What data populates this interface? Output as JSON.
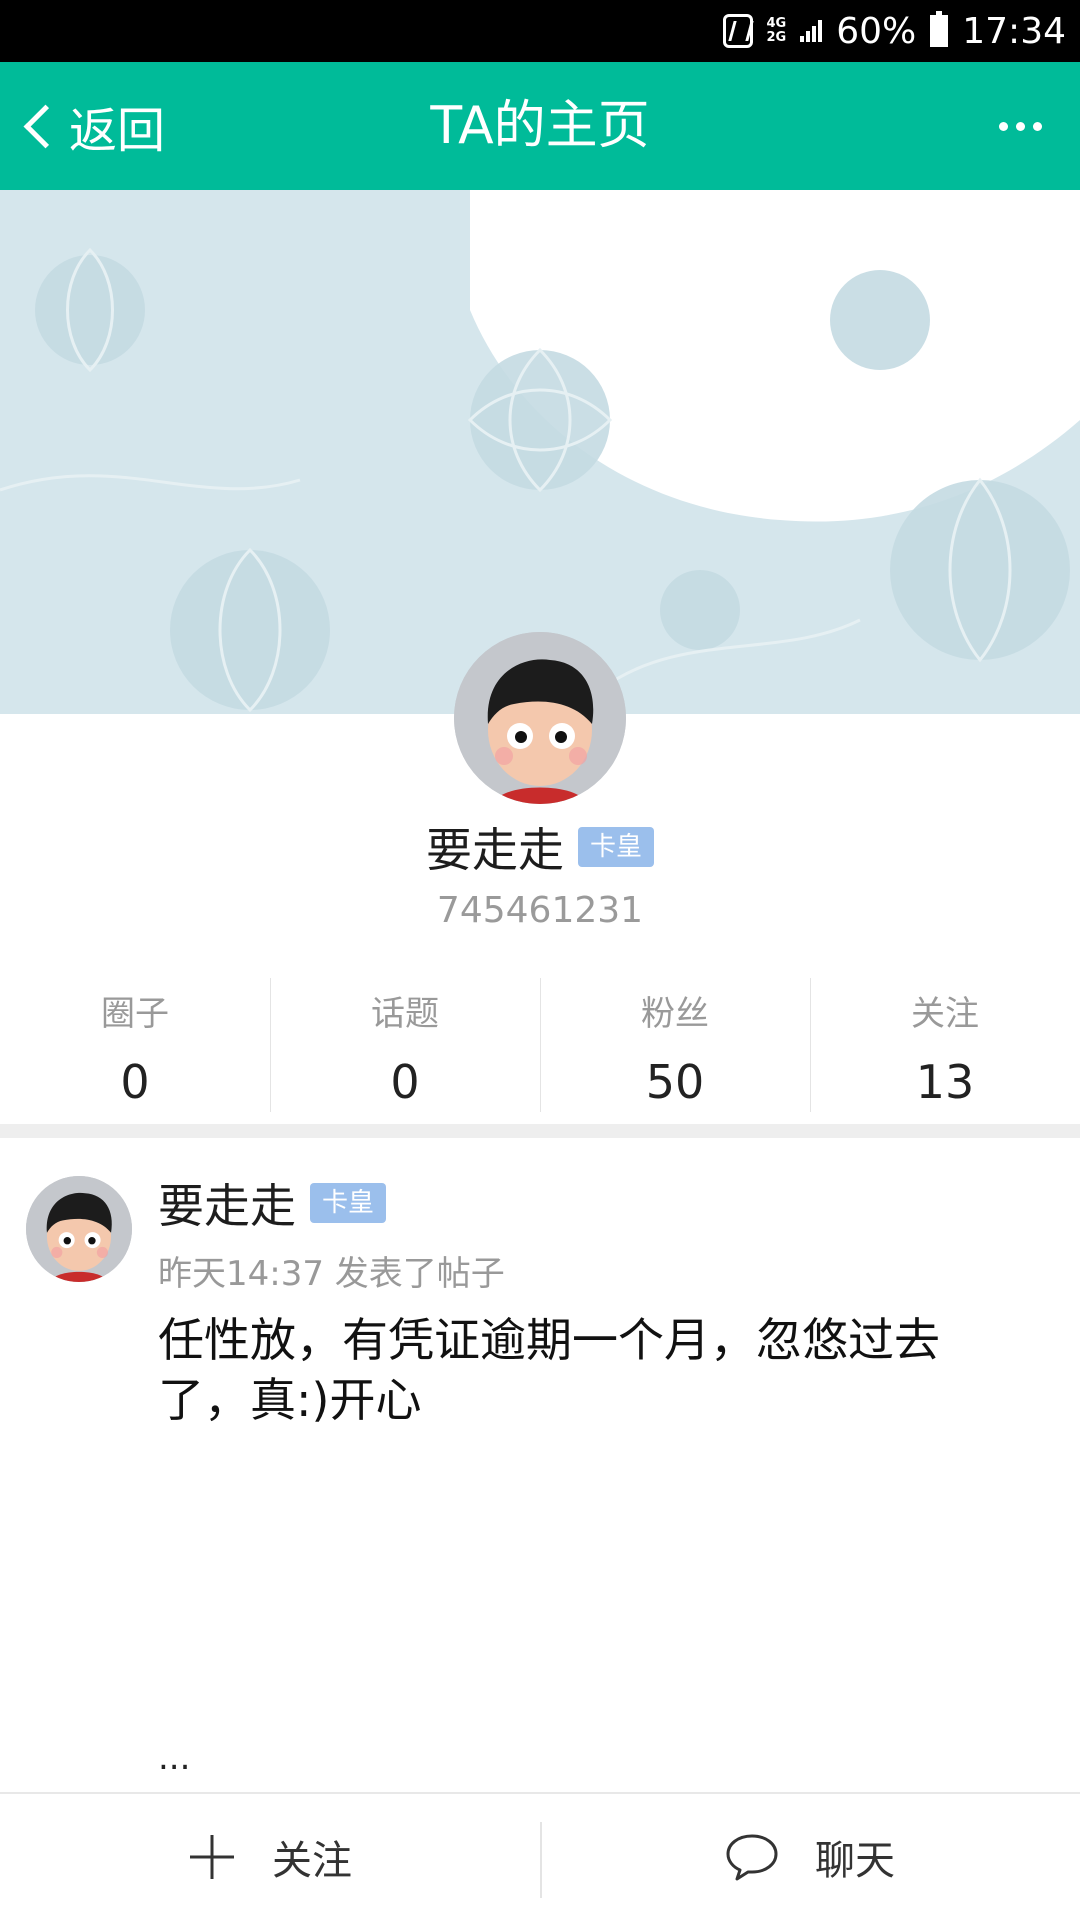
{
  "status_bar": {
    "net_top": "4G",
    "net_bottom": "2G",
    "battery": "60%",
    "time": "17:34"
  },
  "nav": {
    "back_label": "返回",
    "title": "TA的主页",
    "accent_color": "#00bb99"
  },
  "profile": {
    "name": "要走走",
    "badge": "卡皇",
    "id": "745461231"
  },
  "stats": [
    {
      "label": "圈子",
      "value": "0"
    },
    {
      "label": "话题",
      "value": "0"
    },
    {
      "label": "粉丝",
      "value": "50"
    },
    {
      "label": "关注",
      "value": "13"
    }
  ],
  "post": {
    "author": "要走走",
    "badge": "卡皇",
    "meta": "昨天14:37 发表了帖子",
    "text": "任性放，有凭证逾期一个月，忽悠过去了，真:)开心",
    "more": "..."
  },
  "bottom": {
    "follow_label": "关注",
    "chat_label": "聊天",
    "follow_icon": "plus-icon",
    "chat_icon": "chat-bubble-icon"
  }
}
